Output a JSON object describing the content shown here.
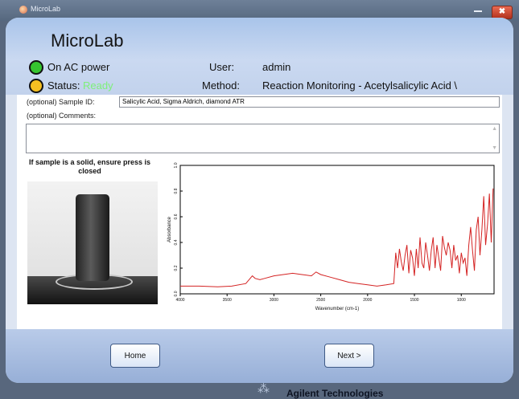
{
  "window": {
    "title": "MicroLab",
    "close_glyph": "✖"
  },
  "header": {
    "app_title": "MicroLab",
    "power_label": "On AC power",
    "status_label": "Status:",
    "status_value": "Ready",
    "user_label": "User:",
    "user_value": "admin",
    "method_label": "Method:",
    "method_value": "Reaction Monitoring - Acetylsalicylic Acid \\"
  },
  "form": {
    "sample_id_label": "(optional) Sample ID:",
    "sample_id_value": "Salicylic Acid, Sigma Aldrich, diamond ATR",
    "comments_label": "(optional) Comments:",
    "comments_value": ""
  },
  "instruction": "If sample is a solid, ensure press is closed",
  "chart_data": {
    "type": "line",
    "xlabel": "Wavenumber (cm-1)",
    "ylabel": "Absorbance",
    "xlim": [
      4000,
      650
    ],
    "ylim": [
      0,
      1.0
    ],
    "xticks": [
      "4000",
      "3500",
      "3000",
      "2500",
      "2000",
      "1500",
      "1000"
    ],
    "yticks": [
      "0.0",
      "0.2",
      "0.4",
      "0.6",
      "0.8",
      "1.0"
    ],
    "color": "#d42323",
    "series": [
      {
        "x": [
          4000,
          3800,
          3600,
          3450,
          3300,
          3230,
          3200,
          3150,
          3100,
          3000,
          2900,
          2800,
          2700,
          2600,
          2550,
          2500,
          2400,
          2300,
          2200,
          2100,
          2000,
          1900,
          1800,
          1720,
          1700,
          1680,
          1660,
          1640,
          1620,
          1600,
          1580,
          1560,
          1540,
          1520,
          1500,
          1480,
          1460,
          1440,
          1420,
          1400,
          1380,
          1360,
          1340,
          1320,
          1300,
          1280,
          1260,
          1240,
          1220,
          1200,
          1180,
          1160,
          1140,
          1120,
          1100,
          1080,
          1060,
          1040,
          1020,
          1000,
          980,
          960,
          940,
          920,
          900,
          880,
          860,
          840,
          820,
          800,
          780,
          760,
          740,
          720,
          700,
          680,
          660
        ],
        "y": [
          0.06,
          0.06,
          0.055,
          0.06,
          0.08,
          0.14,
          0.12,
          0.11,
          0.12,
          0.14,
          0.15,
          0.16,
          0.15,
          0.14,
          0.17,
          0.15,
          0.13,
          0.11,
          0.09,
          0.08,
          0.07,
          0.06,
          0.07,
          0.08,
          0.32,
          0.2,
          0.35,
          0.25,
          0.18,
          0.3,
          0.38,
          0.16,
          0.34,
          0.28,
          0.14,
          0.35,
          0.2,
          0.44,
          0.24,
          0.2,
          0.4,
          0.3,
          0.18,
          0.34,
          0.44,
          0.2,
          0.38,
          0.28,
          0.18,
          0.45,
          0.36,
          0.3,
          0.4,
          0.34,
          0.2,
          0.38,
          0.26,
          0.3,
          0.16,
          0.32,
          0.24,
          0.28,
          0.14,
          0.38,
          0.52,
          0.34,
          0.18,
          0.5,
          0.6,
          0.3,
          0.5,
          0.76,
          0.38,
          0.54,
          0.78,
          0.4,
          0.82
        ]
      }
    ]
  },
  "footer": {
    "home_label": "Home",
    "next_label": "Next >",
    "brand_text": "Agilent Technologies",
    "brand_glyph": "⁂"
  }
}
